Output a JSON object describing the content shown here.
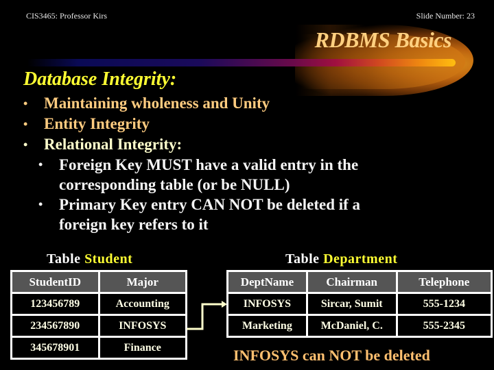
{
  "header": {
    "course": "CIS3465: Professor Kirs",
    "slide_number": "Slide Number: 23"
  },
  "title": "RDBMS Basics",
  "heading": "Database Integrity:",
  "bullets": [
    {
      "text": "Maintaining wholeness and Unity",
      "color": "#ffcc80"
    },
    {
      "text": "Entity Integrity",
      "color": "#ffcc80"
    },
    {
      "text": "Relational Integrity:",
      "color": "#ffffcc",
      "sub": [
        {
          "line1": "Foreign Key MUST have a valid entry in the",
          "line2": "corresponding table (or be NULL)"
        },
        {
          "line1": "Primary Key entry CAN NOT be deleted if a",
          "line2": "foreign key refers to it"
        }
      ]
    }
  ],
  "bullet_glyph": "•",
  "student_table": {
    "caption_prefix": "Table",
    "caption_name": "Student",
    "columns": [
      "StudentID",
      "Major"
    ],
    "rows": [
      [
        "123456789",
        "Accounting"
      ],
      [
        "234567890",
        "INFOSYS"
      ],
      [
        "345678901",
        "Finance"
      ]
    ]
  },
  "department_table": {
    "caption_prefix": "Table",
    "caption_name": "Department",
    "columns": [
      "DeptName",
      "Chairman",
      "Telephone"
    ],
    "rows": [
      [
        "INFOSYS",
        "Sircar, Sumit",
        "555-1234"
      ],
      [
        "Marketing",
        "McDaniel, C.",
        "555-2345"
      ]
    ]
  },
  "note": "INFOSYS can NOT be deleted",
  "colors": {
    "heading": "#ffff33",
    "title": "#ffd080",
    "highlight": "#ffff33",
    "arrow": "#ffffcc"
  }
}
